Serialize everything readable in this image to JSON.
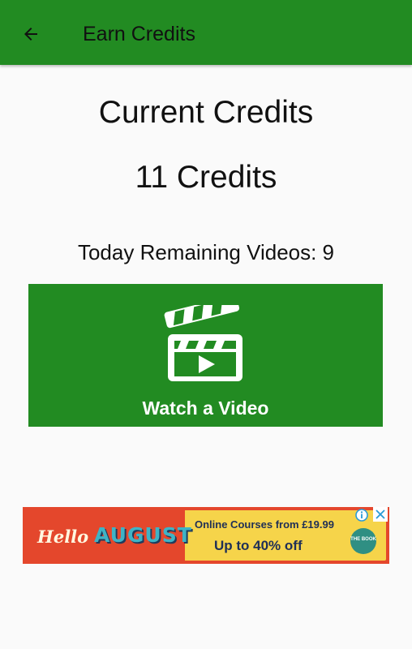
{
  "app_bar": {
    "title": "Earn Credits",
    "back_icon": "arrow-back-icon",
    "background_color": "#228b22"
  },
  "main": {
    "current_label": "Current Credits",
    "credits_value": "11 Credits",
    "remaining_text": "Today Remaining Videos: 9"
  },
  "watch_button": {
    "label": "Watch a Video",
    "icon": "video-clapperboard-icon",
    "background_color": "#228b22"
  },
  "ad": {
    "hello_text": "Hello",
    "august_text": "AUGUST",
    "courses_text": "Online Courses from £19.99",
    "discount_text": "Up to 40% off",
    "badge_text": "THE BOOK",
    "info_icon": "info-icon",
    "close_icon": "close-icon"
  }
}
